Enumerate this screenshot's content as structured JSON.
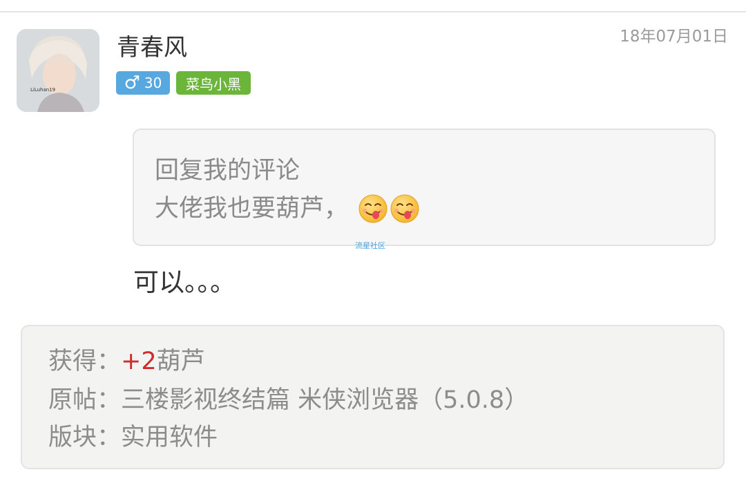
{
  "post": {
    "username": "青春风",
    "timestamp": "18年07月01日",
    "gender_symbol": "♂",
    "age": "30",
    "level_badge": "菜鸟小黑",
    "avatar_icon": "user-avatar-photo"
  },
  "quote": {
    "line1": "回复我的评论",
    "line2": "大佬我也要葫芦，",
    "emojis": [
      "yum-face-emoji",
      "yum-face-emoji"
    ]
  },
  "watermark": "流星社区",
  "reply": {
    "text": "可以。。。"
  },
  "info": {
    "reward_label": "获得：",
    "reward_value": "+2",
    "reward_unit": "葫芦",
    "source_label": "原帖：",
    "source_value": "三楼影视终结篇 米侠浏览器（5.0.8）",
    "board_label": "版块：",
    "board_value": "实用软件"
  },
  "colors": {
    "gender_badge": "#58a8e0",
    "level_badge": "#6ab53a",
    "reward_value": "#d12b2b"
  }
}
